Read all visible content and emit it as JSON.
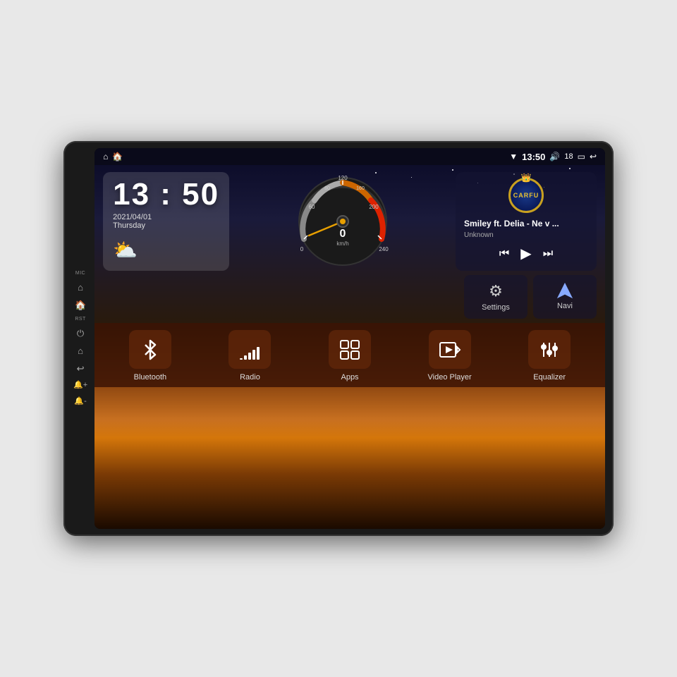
{
  "device": {
    "side_buttons": [
      {
        "label": "MIC",
        "icon": ""
      },
      {
        "label": "",
        "icon": "⌂"
      },
      {
        "label": "",
        "icon": "🏠"
      },
      {
        "label": "RST",
        "icon": ""
      },
      {
        "label": "",
        "icon": "⏻"
      },
      {
        "label": "",
        "icon": "⌂"
      },
      {
        "label": "",
        "icon": "↩"
      },
      {
        "label": "",
        "icon": "🔔"
      },
      {
        "label": "",
        "icon": "📢"
      }
    ]
  },
  "status_bar": {
    "left_icons": [
      "⌂",
      "🏠"
    ],
    "wifi_icon": "▼",
    "time": "13:50",
    "volume_icon": "🔊",
    "volume_level": "18",
    "window_icon": "▭",
    "back_icon": "↩"
  },
  "clock": {
    "time": "13 : 50",
    "date": "2021/04/01",
    "day": "Thursday"
  },
  "weather": {
    "icon": "⛅"
  },
  "music": {
    "logo_text": "CARFU",
    "title": "Smiley ft. Delia - Ne v ...",
    "artist": "Unknown",
    "prev_icon": "⏮",
    "play_icon": "▶",
    "next_icon": "⏭"
  },
  "speedometer": {
    "speed": "0",
    "unit": "km/h",
    "max": "240"
  },
  "shortcuts": [
    {
      "label": "Settings",
      "icon": "⚙"
    },
    {
      "label": "Navi",
      "icon": "⬆"
    }
  ],
  "apps": [
    {
      "label": "Bluetooth",
      "icon": "bluetooth"
    },
    {
      "label": "Radio",
      "icon": "radio"
    },
    {
      "label": "Apps",
      "icon": "apps"
    },
    {
      "label": "Video Player",
      "icon": "video"
    },
    {
      "label": "Equalizer",
      "icon": "eq"
    }
  ]
}
